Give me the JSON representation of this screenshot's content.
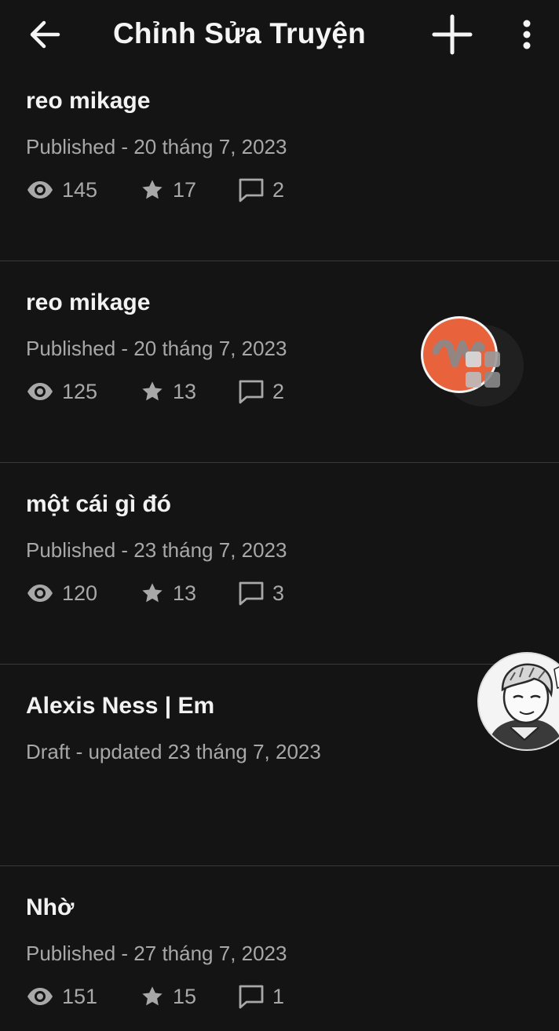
{
  "header": {
    "title": "Chỉnh Sửa Truyện",
    "back_icon": "arrow-left-icon",
    "add_icon": "plus-icon",
    "more_icon": "more-vertical-icon"
  },
  "stories": [
    {
      "title": "reo mikage",
      "meta": "Published - 20 tháng 7, 2023",
      "views": "145",
      "votes": "17",
      "comments": "2"
    },
    {
      "title": "reo mikage",
      "meta": "Published - 20 tháng 7, 2023",
      "views": "125",
      "votes": "13",
      "comments": "2"
    },
    {
      "title": "một cái gì đó",
      "meta": "Published - 23 tháng 7, 2023",
      "views": "120",
      "votes": "13",
      "comments": "3"
    },
    {
      "title": "Alexis Ness | Em",
      "meta": "Draft - updated 23 tháng 7, 2023"
    },
    {
      "title": "Nhờ",
      "meta": "Published - 27 tháng 7, 2023",
      "views": "151",
      "votes": "15",
      "comments": "1"
    }
  ],
  "floating": {
    "wattpad_bubble": "wattpad-logo-icon",
    "avatar_bubble": "chat-head-avatar"
  },
  "colors": {
    "background": "#141414",
    "text_primary": "#f2f2f2",
    "text_secondary": "#a8a8a8",
    "divider": "#3a3a3a",
    "wattpad_orange": "#e8623b"
  }
}
